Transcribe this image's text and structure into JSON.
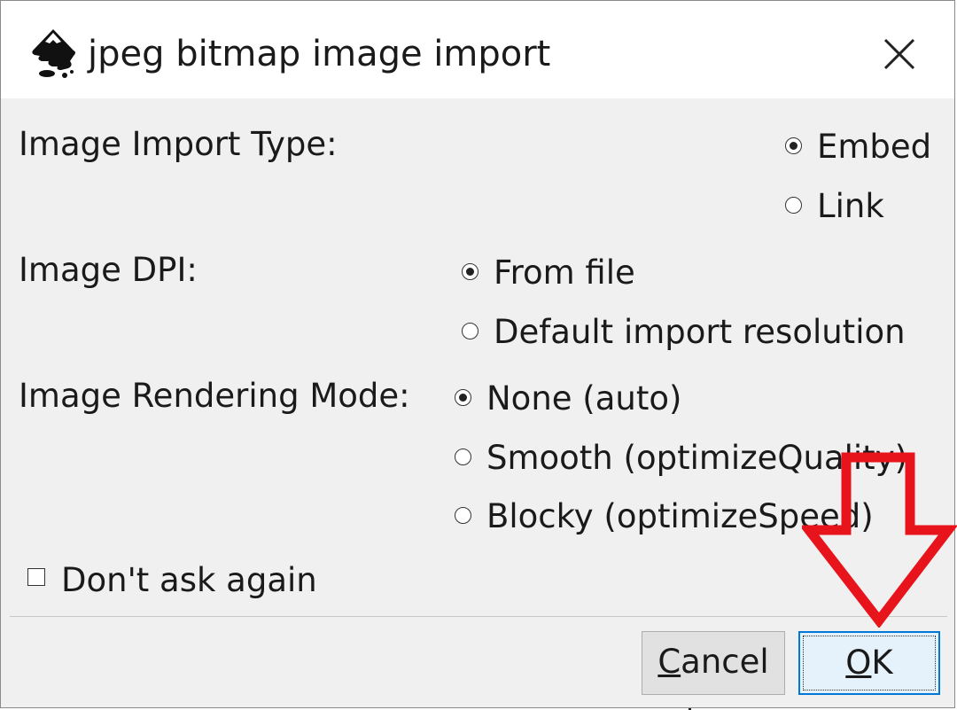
{
  "window": {
    "title": "jpeg bitmap image import",
    "app_icon": "inkscape-logo-icon",
    "close_icon": "close-icon"
  },
  "import_type": {
    "label": "Image Import Type:",
    "options": [
      {
        "label": "Embed",
        "checked": true
      },
      {
        "label": "Link",
        "checked": false
      }
    ]
  },
  "dpi": {
    "label": "Image DPI:",
    "options": [
      {
        "label": "From file",
        "checked": true
      },
      {
        "label": "Default import resolution",
        "checked": false
      }
    ]
  },
  "rendering": {
    "label": "Image Rendering Mode:",
    "options": [
      {
        "label": "None (auto)",
        "checked": true
      },
      {
        "label": "Smooth (optimizeQuality)",
        "checked": false
      },
      {
        "label": "Blocky (optimizeSpeed)",
        "checked": false
      }
    ]
  },
  "dont_ask": {
    "label": "Don't ask again",
    "checked": false
  },
  "buttons": {
    "cancel": {
      "mnemonic": "C",
      "rest": "ancel"
    },
    "ok": {
      "mnemonic": "O",
      "rest": "K"
    }
  },
  "annotation": {
    "icon": "down-arrow-icon",
    "color": "#e8141c"
  }
}
